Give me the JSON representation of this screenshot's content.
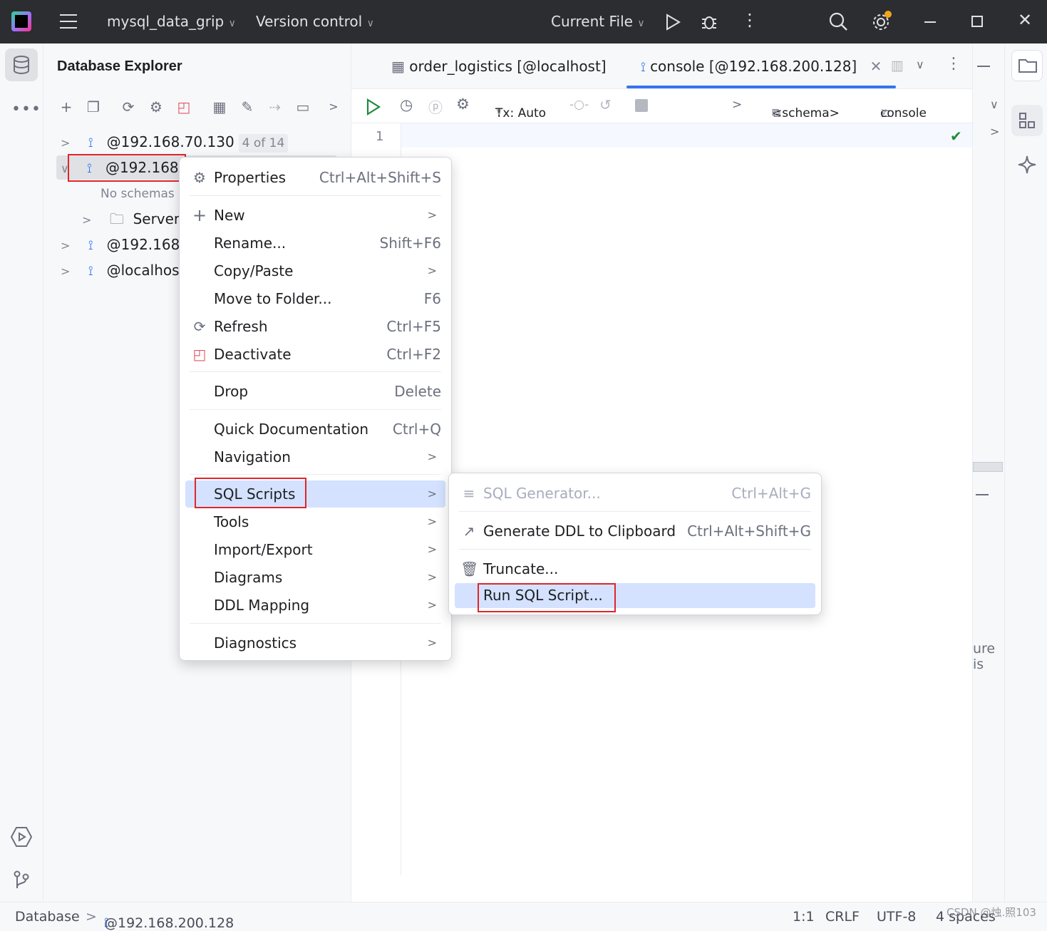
{
  "titlebar": {
    "project": "mysql_data_grip",
    "vcs": "Version control",
    "run_config": "Current File"
  },
  "explorer": {
    "title": "Database Explorer",
    "tree": [
      {
        "label": "@192.168.70.130",
        "badge": "4 of 14"
      },
      {
        "label": "@192.168.2",
        "expanded": true
      },
      {
        "label": "No schemas s"
      },
      {
        "label": "Server O"
      },
      {
        "label": "@192.168.2"
      },
      {
        "label": "@localhost"
      }
    ]
  },
  "editor": {
    "tabs": [
      {
        "label": "order_logistics [@localhost]"
      },
      {
        "label": "console [@192.168.200.128]"
      }
    ],
    "tx": "Tx: Auto",
    "schema": "<schema>",
    "session": "console",
    "line_number": "1",
    "fragment": "ure is"
  },
  "context_menu": {
    "items": [
      {
        "label": "Properties",
        "shortcut": "Ctrl+Alt+Shift+S"
      },
      {
        "label": "New"
      },
      {
        "label": "Rename...",
        "shortcut": "Shift+F6"
      },
      {
        "label": "Copy/Paste"
      },
      {
        "label": "Move to Folder...",
        "shortcut": "F6"
      },
      {
        "label": "Refresh",
        "shortcut": "Ctrl+F5"
      },
      {
        "label": "Deactivate",
        "shortcut": "Ctrl+F2"
      },
      {
        "label": "Drop",
        "shortcut": "Delete"
      },
      {
        "label": "Quick Documentation",
        "shortcut": "Ctrl+Q"
      },
      {
        "label": "Navigation"
      },
      {
        "label": "SQL Scripts"
      },
      {
        "label": "Tools"
      },
      {
        "label": "Import/Export"
      },
      {
        "label": "Diagrams"
      },
      {
        "label": "DDL Mapping"
      },
      {
        "label": "Diagnostics"
      }
    ]
  },
  "submenu": {
    "items": [
      {
        "label": "SQL Generator...",
        "shortcut": "Ctrl+Alt+G"
      },
      {
        "label": "Generate DDL to Clipboard",
        "shortcut": "Ctrl+Alt+Shift+G"
      },
      {
        "label": "Truncate..."
      },
      {
        "label": "Run SQL Script..."
      }
    ]
  },
  "statusbar": {
    "breadcrumb_root": "Database",
    "breadcrumb_node": "@192.168.200.128",
    "position": "1:1",
    "line_sep": "CRLF",
    "encoding": "UTF-8",
    "indent": "4 spaces",
    "watermark": "CSDN @烛.照103"
  },
  "colors": {
    "accent": "#3574f0",
    "highlight_box": "#e0262b",
    "selection": "#d4e2ff"
  }
}
